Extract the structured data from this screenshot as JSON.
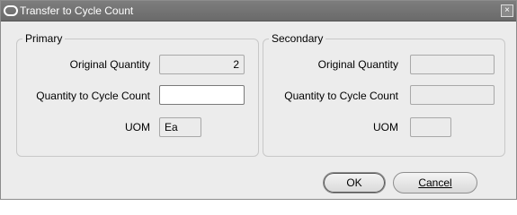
{
  "window": {
    "title": "Transfer to Cycle Count",
    "close_glyph": "×"
  },
  "primary": {
    "legend": "Primary",
    "original_quantity_label": "Original Quantity",
    "original_quantity_value": "2",
    "qty_to_cycle_count_label": "Quantity to Cycle Count",
    "qty_to_cycle_count_value": "",
    "uom_label": "UOM",
    "uom_value": "Ea"
  },
  "secondary": {
    "legend": "Secondary",
    "original_quantity_label": "Original Quantity",
    "original_quantity_value": "",
    "qty_to_cycle_count_label": "Quantity to Cycle Count",
    "qty_to_cycle_count_value": "",
    "uom_label": "UOM",
    "uom_value": ""
  },
  "buttons": {
    "ok_label": "OK",
    "cancel_label": "Cancel"
  }
}
